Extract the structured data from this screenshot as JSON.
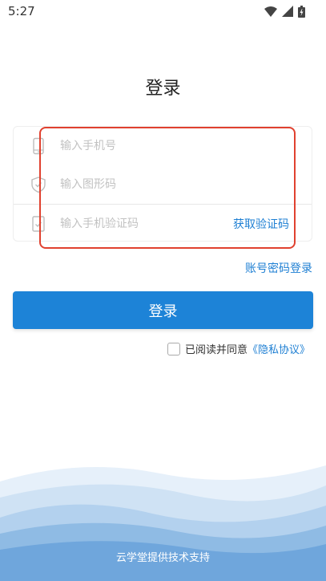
{
  "status_bar": {
    "time": "5:27",
    "icons": [
      "wifi-icon",
      "signal-icon",
      "battery-icon"
    ]
  },
  "page": {
    "title": "登录"
  },
  "form": {
    "phone_placeholder": "输入手机号",
    "captcha_placeholder": "输入图形码",
    "sms_code_placeholder": "输入手机验证码",
    "get_code_label": "获取验证码",
    "icons": [
      "phone-icon",
      "shield-icon",
      "clipboard-check-icon"
    ]
  },
  "links": {
    "password_login": "账号密码登录"
  },
  "login_button": {
    "label": "登录"
  },
  "agreement": {
    "text": "已阅读并同意",
    "link": "《隐私协议》",
    "checked": false
  },
  "footer": {
    "text": "云学堂提供技术支持"
  },
  "colors": {
    "accent": "#1d83d7",
    "link": "#1e7fd3",
    "highlight_border": "#e0412f"
  }
}
